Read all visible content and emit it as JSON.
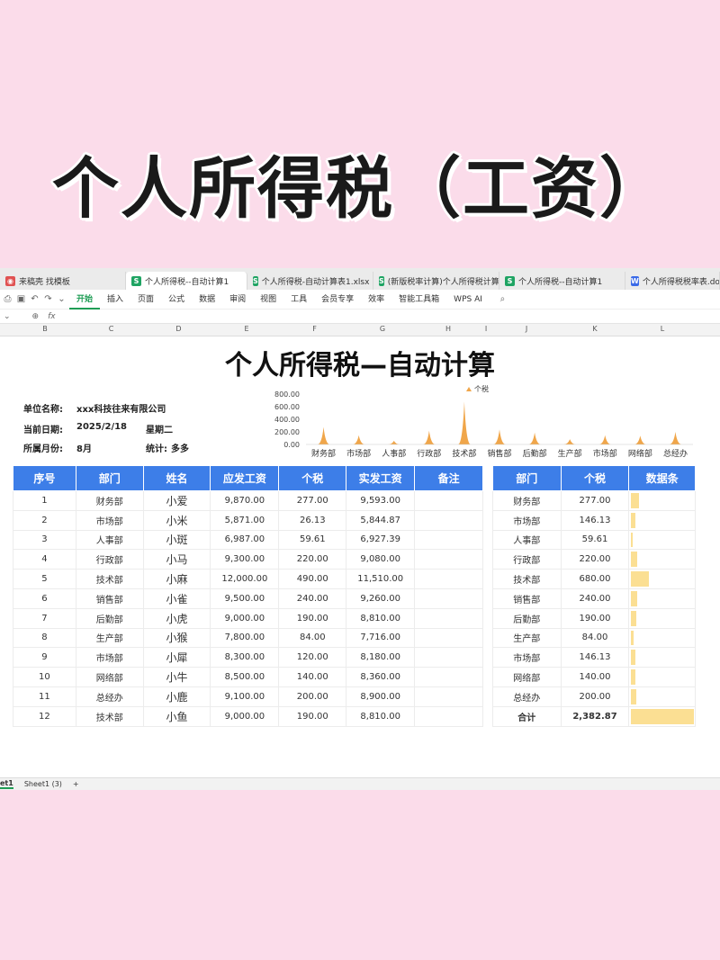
{
  "banner": {
    "title": "个人所得税（工资）"
  },
  "tabs": [
    {
      "label": "来稿壳 找模板",
      "icon": "r"
    },
    {
      "label": "个人所得税--自动计算1",
      "icon": "s",
      "active": true
    },
    {
      "label": "个人所得税-自动计算表1.xlsx",
      "icon": "s"
    },
    {
      "label": "(新版税率计算)个人所得税计算器",
      "icon": "s"
    },
    {
      "label": "个人所得税--自动计算1",
      "icon": "s"
    },
    {
      "label": "个人所得税税率表.docx",
      "icon": "w"
    }
  ],
  "menu": [
    "开始",
    "插入",
    "页面",
    "公式",
    "数据",
    "审阅",
    "视图",
    "工具",
    "会员专享",
    "效率",
    "智能工具箱",
    "WPS AI"
  ],
  "formula": {
    "fx": "fx"
  },
  "columns": [
    "B",
    "C",
    "D",
    "E",
    "F",
    "G",
    "H",
    "I",
    "J",
    "K",
    "L"
  ],
  "sheet": {
    "title": "个人所得税—自动计算",
    "info": {
      "company_label": "单位名称:",
      "company": "xxx科技往来有限公司",
      "date_label": "当前日期:",
      "date": "2025/2/18",
      "weekday": "星期二",
      "month_label": "所属月份:",
      "month": "8月",
      "stat_label": "统计:",
      "stat": "多多"
    }
  },
  "chart_data": {
    "type": "area",
    "legend": "个税",
    "legend_position": "top-right",
    "categories": [
      "财务部",
      "市场部",
      "人事部",
      "行政部",
      "技术部",
      "销售部",
      "后勤部",
      "生产部",
      "市场部",
      "网络部",
      "总经办"
    ],
    "values": [
      277,
      146.13,
      59.61,
      220,
      680,
      240,
      190,
      84,
      146.13,
      140,
      200
    ],
    "y_ticks": [
      "800.00",
      "600.00",
      "400.00",
      "200.00",
      "0.00"
    ],
    "ylim": [
      0,
      800
    ],
    "color": "#f0a64a"
  },
  "table": {
    "headers": [
      "序号",
      "部门",
      "姓名",
      "应发工资",
      "个税",
      "实发工资",
      "备注"
    ],
    "rows": [
      [
        "1",
        "财务部",
        "小爱",
        "9,870.00",
        "277.00",
        "9,593.00",
        ""
      ],
      [
        "2",
        "市场部",
        "小米",
        "5,871.00",
        "26.13",
        "5,844.87",
        ""
      ],
      [
        "3",
        "人事部",
        "小斑",
        "6,987.00",
        "59.61",
        "6,927.39",
        ""
      ],
      [
        "4",
        "行政部",
        "小马",
        "9,300.00",
        "220.00",
        "9,080.00",
        ""
      ],
      [
        "5",
        "技术部",
        "小麻",
        "12,000.00",
        "490.00",
        "11,510.00",
        ""
      ],
      [
        "6",
        "销售部",
        "小雀",
        "9,500.00",
        "240.00",
        "9,260.00",
        ""
      ],
      [
        "7",
        "后勤部",
        "小虎",
        "9,000.00",
        "190.00",
        "8,810.00",
        ""
      ],
      [
        "8",
        "生产部",
        "小猴",
        "7,800.00",
        "84.00",
        "7,716.00",
        ""
      ],
      [
        "9",
        "市场部",
        "小犀",
        "8,300.00",
        "120.00",
        "8,180.00",
        ""
      ],
      [
        "10",
        "网络部",
        "小牛",
        "8,500.00",
        "140.00",
        "8,360.00",
        ""
      ],
      [
        "11",
        "总经办",
        "小鹿",
        "9,100.00",
        "200.00",
        "8,900.00",
        ""
      ],
      [
        "12",
        "技术部",
        "小鱼",
        "9,000.00",
        "190.00",
        "8,810.00",
        ""
      ]
    ]
  },
  "summary": {
    "headers": [
      "部门",
      "个税",
      "数据条"
    ],
    "rows": [
      {
        "dept": "财务部",
        "tax": "277.00",
        "bar": 0.116
      },
      {
        "dept": "市场部",
        "tax": "146.13",
        "bar": 0.061
      },
      {
        "dept": "人事部",
        "tax": "59.61",
        "bar": 0.025
      },
      {
        "dept": "行政部",
        "tax": "220.00",
        "bar": 0.092
      },
      {
        "dept": "技术部",
        "tax": "680.00",
        "bar": 0.285
      },
      {
        "dept": "销售部",
        "tax": "240.00",
        "bar": 0.101
      },
      {
        "dept": "后勤部",
        "tax": "190.00",
        "bar": 0.08
      },
      {
        "dept": "生产部",
        "tax": "84.00",
        "bar": 0.035
      },
      {
        "dept": "市场部",
        "tax": "146.13",
        "bar": 0.061
      },
      {
        "dept": "网络部",
        "tax": "140.00",
        "bar": 0.059
      },
      {
        "dept": "总经办",
        "tax": "200.00",
        "bar": 0.084
      }
    ],
    "total_label": "合计",
    "total": "2,382.87",
    "total_bar": 1.0
  },
  "sheet_tabs": [
    "et1",
    "Sheet1 (3)",
    "+"
  ]
}
